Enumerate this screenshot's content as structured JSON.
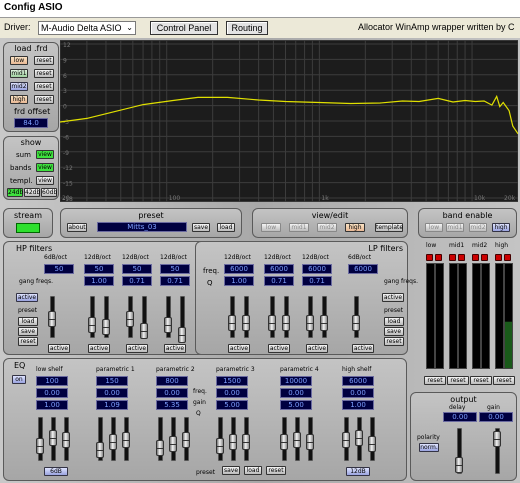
{
  "window": {
    "title": "Config ASIO"
  },
  "toolbar": {
    "driver_label": "Driver:",
    "driver_value": "M-Audio Delta ASIO",
    "control_panel": "Control Panel",
    "routing": "Routing",
    "credit": "Allocator WinAmp wrapper written by C"
  },
  "graph": {
    "y_ticks": [
      "12",
      "9",
      "6",
      "3",
      "0",
      "-3",
      "-6",
      "-9",
      "-12",
      "-15",
      "-18"
    ],
    "x_ticks": [
      "20",
      "100",
      "1k",
      "10k",
      "20k"
    ]
  },
  "loadfrd": {
    "title": "load .frd",
    "low": "low",
    "mid1": "mid1",
    "mid2": "mid2",
    "high": "high",
    "reset": "reset",
    "offset_label": "frd offset",
    "offset_value": "84.0"
  },
  "show": {
    "title": "show",
    "sum": "sum",
    "bands": "bands",
    "templ": "templ.",
    "view": "view",
    "db24": "24db",
    "db42": "42db",
    "db60": "60db"
  },
  "stream": {
    "title": "stream"
  },
  "preset": {
    "title": "preset",
    "about": "about",
    "name": "Mitts_03",
    "save": "save",
    "load": "load"
  },
  "viewedit": {
    "title": "view/edit",
    "low": "low",
    "mid1": "mid1",
    "mid2": "mid2",
    "high": "high",
    "template": "template"
  },
  "bandenable": {
    "title": "band enable",
    "low": "low",
    "mid1": "mid1",
    "mid2": "mid2",
    "high": "high"
  },
  "hp": {
    "title": "HP filters",
    "slopes": [
      "6dB/oct",
      "12dB/oct",
      "12dB/oct",
      "12dB/oct"
    ],
    "freqs": [
      "50",
      "50",
      "50",
      "50"
    ],
    "qs": [
      "",
      "1.00",
      "0.71",
      "0.71"
    ],
    "gang_label": "gang freqs.",
    "gang_btn": "active",
    "preset_label": "preset",
    "load": "load",
    "save": "save",
    "reset": "reset",
    "active": "active"
  },
  "lp": {
    "title": "LP filters",
    "slopes": [
      "12dB/oct",
      "12dB/oct",
      "12dB/oct",
      "6dB/oct"
    ],
    "freqs": [
      "6000",
      "6000",
      "6000",
      "6000"
    ],
    "qs": [
      "1.00",
      "0.71",
      "0.71",
      ""
    ],
    "freq_label": "freq.",
    "q_label": "Q",
    "gang_label": "gang freqs.",
    "gang_btn": "active",
    "preset_label": "preset",
    "load": "load",
    "save": "save",
    "reset": "reset",
    "active": "active"
  },
  "meters": {
    "labels": [
      "low",
      "mid1",
      "mid2",
      "high"
    ],
    "reset": "reset"
  },
  "eq": {
    "title": "EQ",
    "on": "on",
    "bands": [
      "low shelf",
      "parametric 1",
      "parametric 2",
      "parametric 3",
      "parametric 4",
      "high shelf"
    ],
    "freqs": [
      "100",
      "150",
      "800",
      "1500",
      "10000",
      "6000"
    ],
    "gains": [
      "0.00",
      "0.00",
      "0.00",
      "0.00",
      "0.00",
      "0.00"
    ],
    "qs": [
      "1.00",
      "1.09",
      "5.35",
      "5.00",
      "5.00",
      "1.00"
    ],
    "freq_label": "freq.",
    "gain_label": "gain",
    "q_label": "Q",
    "low_db": "6dB",
    "high_db": "12dB",
    "preset_label": "preset",
    "save": "save",
    "load": "load",
    "reset": "reset"
  },
  "output": {
    "title": "output",
    "delay": "delay",
    "gain": "gain",
    "delay_value": "0.00",
    "gain_value": "0.00",
    "polarity": "polarity",
    "norm": "norm."
  },
  "colors": {
    "graph_bg": "#1c1c1c",
    "curve": "#e0e000",
    "accent": "#3de03d"
  }
}
